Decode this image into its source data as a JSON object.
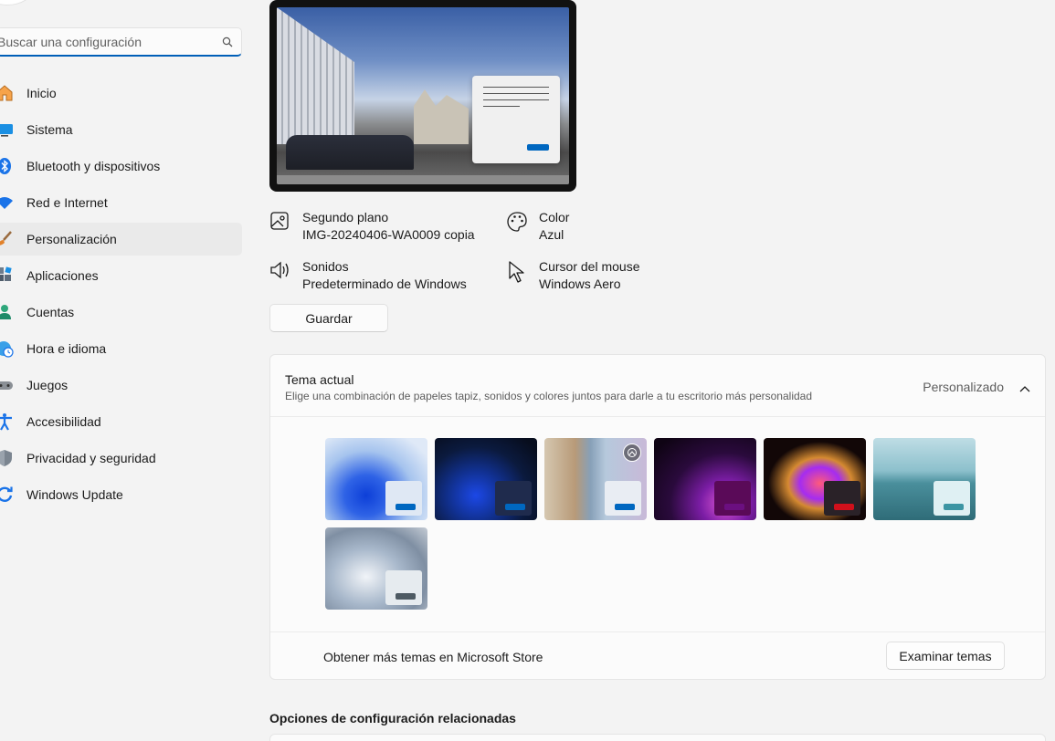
{
  "search": {
    "placeholder": "Buscar una configuración"
  },
  "sidebar": {
    "items": [
      {
        "label": "Inicio",
        "icon": "home-icon"
      },
      {
        "label": "Sistema",
        "icon": "monitor-icon"
      },
      {
        "label": "Bluetooth y dispositivos",
        "icon": "bluetooth-icon"
      },
      {
        "label": "Red e Internet",
        "icon": "wifi-icon"
      },
      {
        "label": "Personalización",
        "icon": "brush-icon",
        "active": true
      },
      {
        "label": "Aplicaciones",
        "icon": "apps-icon"
      },
      {
        "label": "Cuentas",
        "icon": "person-icon"
      },
      {
        "label": "Hora e idioma",
        "icon": "globe-clock-icon"
      },
      {
        "label": "Juegos",
        "icon": "gamepad-icon"
      },
      {
        "label": "Accesibilidad",
        "icon": "accessibility-icon"
      },
      {
        "label": "Privacidad y seguridad",
        "icon": "shield-icon"
      },
      {
        "label": "Windows Update",
        "icon": "update-icon"
      }
    ]
  },
  "theme_info": {
    "background": {
      "title": "Segundo plano",
      "value": "IMG-20240406-WA0009 copia"
    },
    "color": {
      "title": "Color",
      "value": "Azul"
    },
    "sounds": {
      "title": "Sonidos",
      "value": "Predeterminado de Windows"
    },
    "cursor": {
      "title": "Cursor del mouse",
      "value": "Windows Aero"
    }
  },
  "save_button": "Guardar",
  "current_theme": {
    "title": "Tema actual",
    "subtitle": "Elige una combinación de papeles tapiz, sonidos y colores juntos para darle a tu escritorio más personalidad",
    "value": "Personalizado",
    "themes": [
      {
        "name": "windows-light",
        "window_color": "#dfe8f4",
        "accent": "#0067c0"
      },
      {
        "name": "windows-dark",
        "window_color": "#1f2b4d",
        "accent": "#0067c0"
      },
      {
        "name": "glow-flowers",
        "window_color": "#e9edf3",
        "accent": "#0067c0"
      },
      {
        "name": "captured-motion",
        "window_color": "#5a0a58",
        "accent": "#6b0f80"
      },
      {
        "name": "sunrise-bloom",
        "window_color": "#2a2228",
        "accent": "#d0101b"
      },
      {
        "name": "flow-lake",
        "window_color": "#dff0f3",
        "accent": "#3c95a3"
      },
      {
        "name": "windows-spotlight",
        "window_color": "#e6ebef",
        "accent": "#4e5a63"
      }
    ]
  },
  "store": {
    "text": "Obtener más temas en Microsoft Store",
    "button": "Examinar temas"
  },
  "related": {
    "title": "Opciones de configuración relacionadas"
  }
}
